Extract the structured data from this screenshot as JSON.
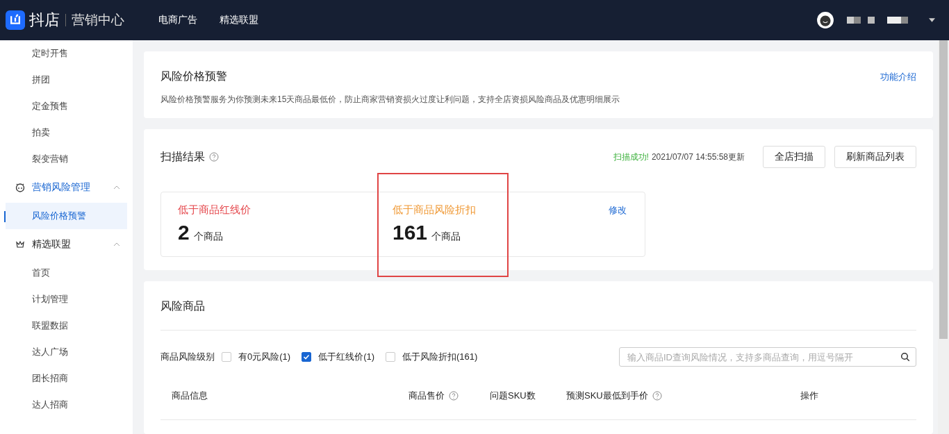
{
  "header": {
    "logo_text": "抖店",
    "subtitle": "营销中心",
    "nav": [
      {
        "label": "电商广告"
      },
      {
        "label": "精选联盟"
      }
    ]
  },
  "sidebar": {
    "items": [
      {
        "kind": "item",
        "label": "定时开售",
        "selected": false
      },
      {
        "kind": "item",
        "label": "拼团",
        "selected": false
      },
      {
        "kind": "item",
        "label": "定金预售",
        "selected": false
      },
      {
        "kind": "item",
        "label": "拍卖",
        "selected": false
      },
      {
        "kind": "item",
        "label": "裂变营销",
        "selected": false
      },
      {
        "kind": "group",
        "label": "营销风险管理",
        "expanded": true,
        "active": true
      },
      {
        "kind": "item",
        "label": "风险价格预警",
        "selected": true
      },
      {
        "kind": "group",
        "label": "精选联盟",
        "expanded": true,
        "active": false
      },
      {
        "kind": "item",
        "label": "首页",
        "selected": false
      },
      {
        "kind": "item",
        "label": "计划管理",
        "selected": false
      },
      {
        "kind": "item",
        "label": "联盟数据",
        "selected": false
      },
      {
        "kind": "item",
        "label": "达人广场",
        "selected": false
      },
      {
        "kind": "item",
        "label": "团长招商",
        "selected": false
      },
      {
        "kind": "item",
        "label": "达人招商",
        "selected": false
      }
    ]
  },
  "intro": {
    "title": "风险价格预警",
    "link": "功能介绍",
    "description": "风险价格预警服务为你预测未来15天商品最低价，防止商家营销资损火过度让利问题，支持全店资损风险商品及优惠明细展示"
  },
  "scan": {
    "title": "扫描结果",
    "status": "扫描成功!",
    "updated": "2021/07/07 14:55:58更新",
    "buttons": [
      "全店扫描",
      "刷新商品列表"
    ],
    "edit_link": "修改",
    "stats": [
      {
        "label": "低于商品红线价",
        "color": "#e5484d",
        "count": "2",
        "unit": "个商品",
        "annotated": false
      },
      {
        "label": "低于商品风险折扣",
        "color": "#f09a37",
        "count": "161",
        "unit": "个商品",
        "annotated": true
      }
    ]
  },
  "risk_products": {
    "title": "风险商品",
    "filter_label": "商品风险级别",
    "filters": [
      {
        "label": "有0元风险(1)",
        "checked": false
      },
      {
        "label": "低于红线价(1)",
        "checked": true
      },
      {
        "label": "低于风险折扣(161)",
        "checked": false
      }
    ],
    "search": {
      "placeholder": "输入商品ID查询风险情况，支持多商品查询，用逗号隔开"
    },
    "columns": [
      {
        "label": "商品信息",
        "help": false
      },
      {
        "label": "商品售价",
        "help": true
      },
      {
        "label": "问题SKU数",
        "help": false
      },
      {
        "label": "预测SKU最低到手价",
        "help": true
      },
      {
        "label": "操作",
        "help": false
      }
    ]
  }
}
